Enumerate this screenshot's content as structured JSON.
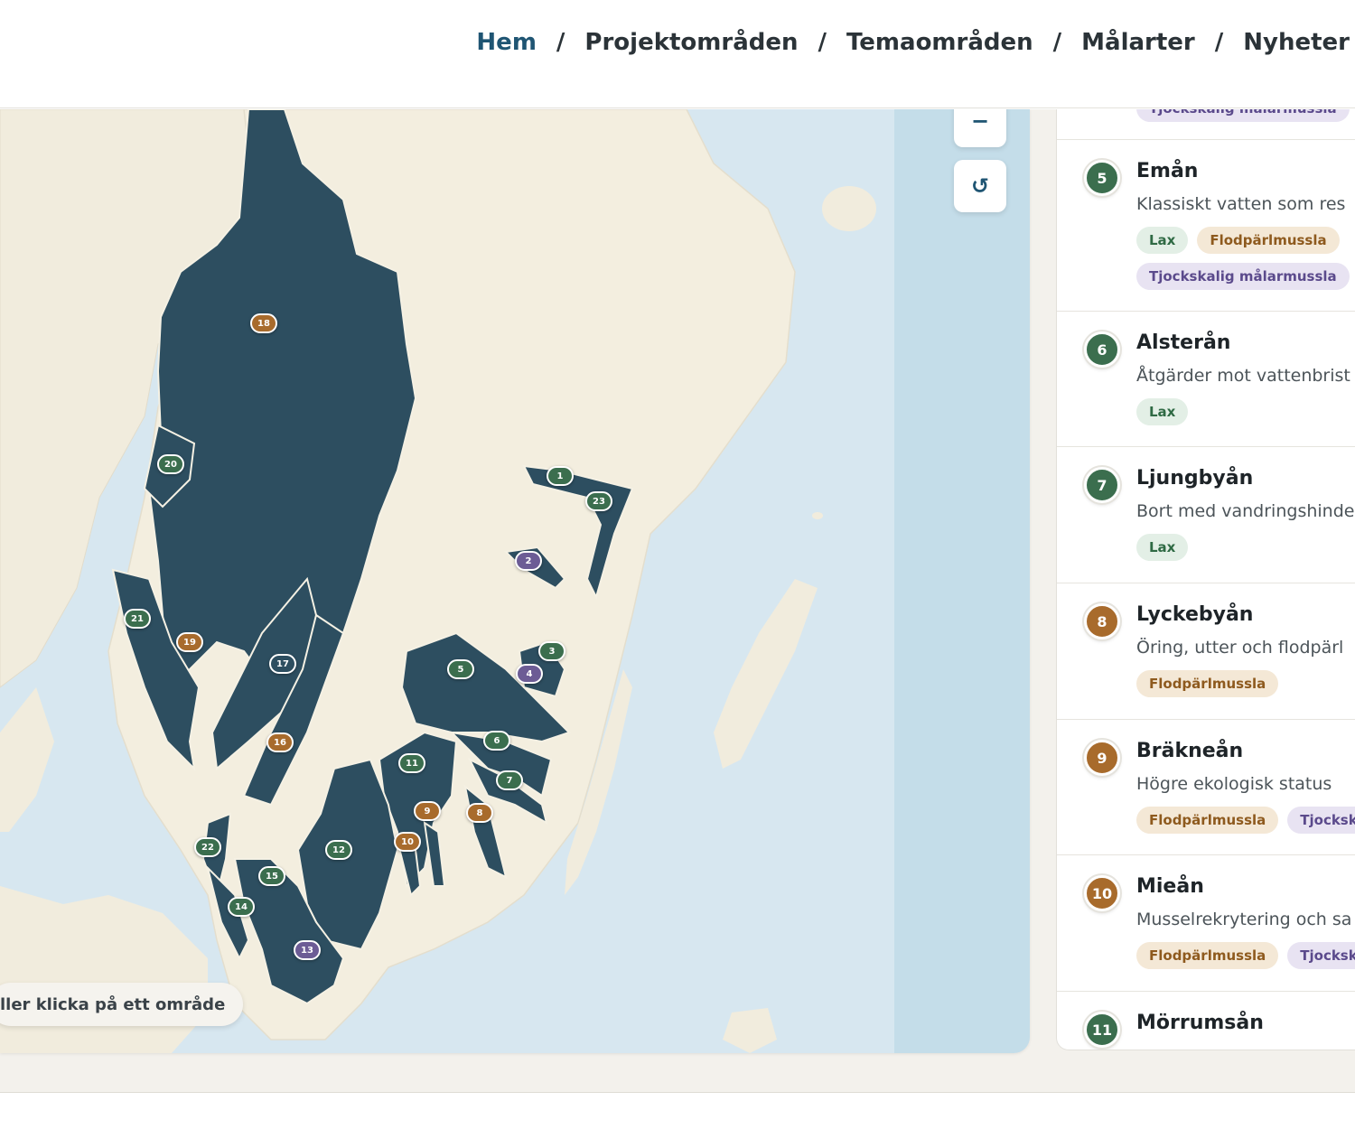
{
  "nav": {
    "links": [
      {
        "label": "Hem",
        "active": true
      },
      {
        "label": "Projektområden",
        "active": false
      },
      {
        "label": "Temaområden",
        "active": false
      },
      {
        "label": "Målarter",
        "active": false
      },
      {
        "label": "Nyheter",
        "active": false
      }
    ],
    "separator": "/"
  },
  "map": {
    "zoom_out_label": "−",
    "reset_icon": "↺",
    "hint": "ller klicka på ett område",
    "markers": [
      "1",
      "2",
      "3",
      "4",
      "5",
      "6",
      "7",
      "8",
      "9",
      "10",
      "11",
      "12",
      "13",
      "14",
      "15",
      "16",
      "17",
      "18",
      "19",
      "20",
      "21",
      "22",
      "23"
    ]
  },
  "panel": {
    "top_tag": "Tjockskalig målarmussla",
    "items": [
      {
        "number": "5",
        "title": "Emån",
        "description": "Klassiskt vatten som res",
        "tags": [
          "Lax",
          "Flodpärlmussla",
          "Tjockskalig målarmussla"
        ]
      },
      {
        "number": "6",
        "title": "Alsterån",
        "description": "Åtgärder mot vattenbrist",
        "tags": [
          "Lax"
        ]
      },
      {
        "number": "7",
        "title": "Ljungbyån",
        "description": "Bort med vandringshinde",
        "tags": [
          "Lax"
        ]
      },
      {
        "number": "8",
        "title": "Lyckebyån",
        "description": "Öring, utter och flodpärl",
        "tags": [
          "Flodpärlmussla"
        ]
      },
      {
        "number": "9",
        "title": "Bräkneån",
        "description": "Högre ekologisk status",
        "tags": [
          "Flodpärlmussla",
          "Tjocksk"
        ]
      },
      {
        "number": "10",
        "title": "Mieån",
        "description": "Musselrekrytering och sa",
        "tags": [
          "Flodpärlmussla",
          "Tjocksk"
        ]
      },
      {
        "number": "11",
        "title": "Mörrumsån",
        "description": "",
        "tags": []
      }
    ]
  },
  "colors": {
    "nav_active": "#1f5573",
    "area_fill": "#2d4e60",
    "land": "#f3eedf",
    "sea": "#d8e8f1",
    "marker_green": "#3b6e4e",
    "marker_brown": "#a86b2c",
    "marker_purple": "#6c5c95"
  }
}
